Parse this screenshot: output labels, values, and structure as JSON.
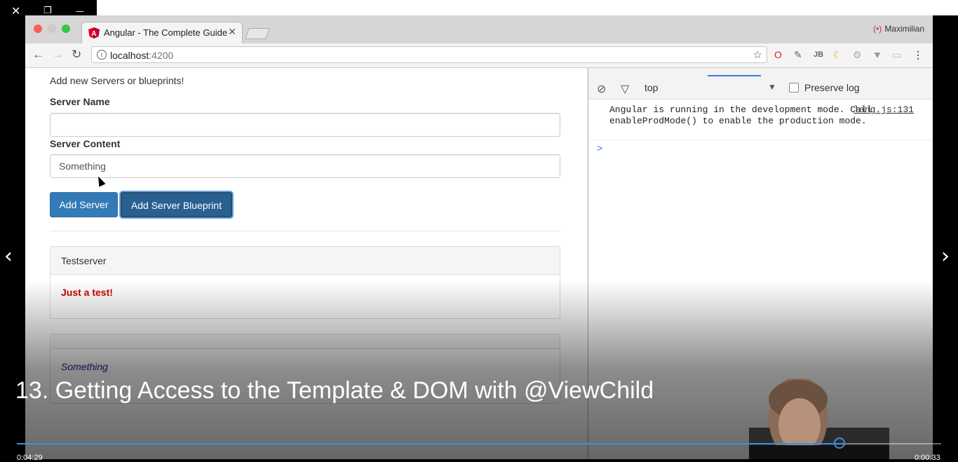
{
  "window_controls": {
    "close": "✕",
    "restore": "❐",
    "minimize": "—"
  },
  "browser": {
    "tab_title": "Angular - The Complete Guide",
    "tab_close": "✕",
    "user_name": "Maximilian",
    "url_host": "localhost",
    "url_port": ":4200",
    "icons": [
      "back-arrow-icon",
      "forward-arrow-icon",
      "reload-icon",
      "info-icon",
      "star-icon",
      "opera-icon",
      "eyedropper-icon",
      "jb-icon",
      "moon-icon",
      "settings-icon",
      "vue-icon",
      "cast-icon",
      "menu-icon"
    ]
  },
  "page": {
    "intro": "Add new Servers or blueprints!",
    "server_name_label": "Server Name",
    "server_name_value": "",
    "server_content_label": "Server Content",
    "server_content_value": "Something",
    "add_server_button": "Add Server",
    "add_blueprint_button": "Add Server Blueprint",
    "panels": [
      {
        "title": "Testserver",
        "content": "Just a test!",
        "kind": "server"
      },
      {
        "title": "",
        "content": "Something",
        "kind": "blueprint"
      }
    ]
  },
  "devtools": {
    "context": "top",
    "preserve_log_label": "Preserve log",
    "preserve_log_checked": false,
    "log_message": "Angular is running in the development mode. Call enableProdMode() to enable the production mode.",
    "log_source": "lang.js:131",
    "prompt": ">"
  },
  "video": {
    "title": "13. Getting Access to the Template & DOM with @ViewChild",
    "time_elapsed": "0:04:29",
    "time_remaining": "0:00:33",
    "progress": 0.89,
    "prev_arrow": "‹",
    "next_arrow": "›"
  },
  "colors": {
    "primary": "#337ab7",
    "progress": "#3a8ee6",
    "danger_text": "#c00000"
  }
}
